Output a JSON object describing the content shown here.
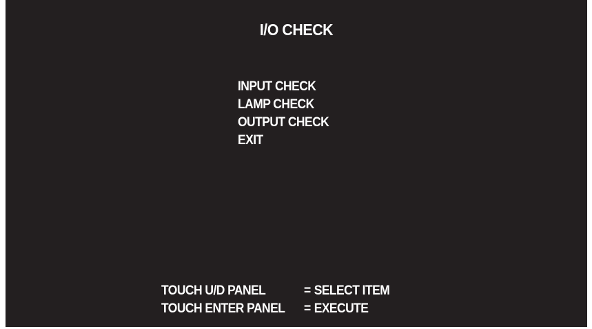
{
  "screen": {
    "title": "I/O CHECK",
    "menu": {
      "items": [
        {
          "label": "INPUT CHECK"
        },
        {
          "label": "LAMP CHECK"
        },
        {
          "label": "OUTPUT CHECK"
        },
        {
          "label": "EXIT"
        }
      ]
    },
    "help": [
      {
        "key": "TOUCH U/D PANEL",
        "sep": "=",
        "action": "SELECT ITEM"
      },
      {
        "key": "TOUCH ENTER PANEL",
        "sep": "=",
        "action": "EXECUTE"
      }
    ]
  },
  "colors": {
    "background": "#231f20",
    "text": "#ffffff"
  }
}
